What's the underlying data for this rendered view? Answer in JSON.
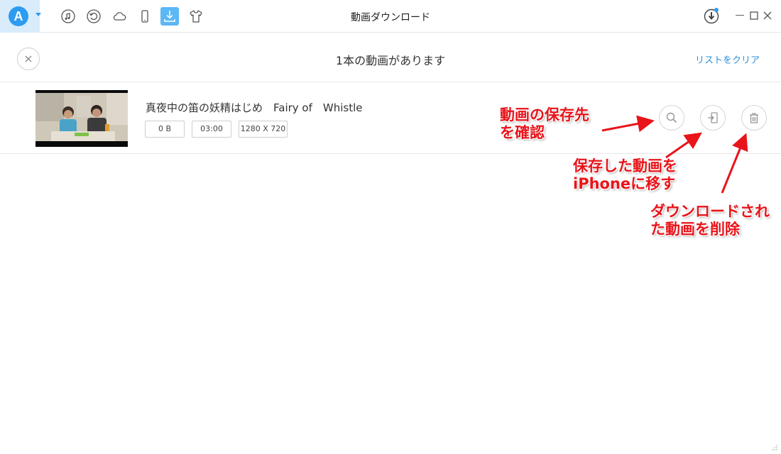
{
  "app": {
    "window_title": "動画ダウンロード",
    "logo_letter": "A"
  },
  "toolbar": {
    "items": [
      {
        "icon": "music-icon",
        "active": false
      },
      {
        "icon": "restore-icon",
        "active": false
      },
      {
        "icon": "cloud-icon",
        "active": false
      },
      {
        "icon": "phone-icon",
        "active": false
      },
      {
        "icon": "download-icon",
        "active": true
      },
      {
        "icon": "tshirt-icon",
        "active": false
      }
    ]
  },
  "header": {
    "title": "1本の動画があります",
    "clear_label": "リストをクリア"
  },
  "video": {
    "title": "真夜中の笛の妖精はじめ　Fairy of　Whistle",
    "size": "0 B",
    "duration": "03:00",
    "resolution": "1280 X 720"
  },
  "actions": [
    {
      "name": "search-location",
      "icon": "search-icon"
    },
    {
      "name": "transfer-to-iphone",
      "icon": "export-to-device-icon"
    },
    {
      "name": "delete",
      "icon": "trash-icon"
    }
  ],
  "annotations": {
    "location_line1": "動画の保存先",
    "location_line2": "を確認",
    "transfer_line1": "保存した動画を",
    "transfer_line2": "iPhoneに移す",
    "delete_line1": "ダウンロードされ",
    "delete_line2": "た動画を削除",
    "color": "#e8141a"
  },
  "colors": {
    "accent": "#2d9bf0",
    "link": "#2d8fd8",
    "active_tool_bg": "#5cb7f5"
  }
}
